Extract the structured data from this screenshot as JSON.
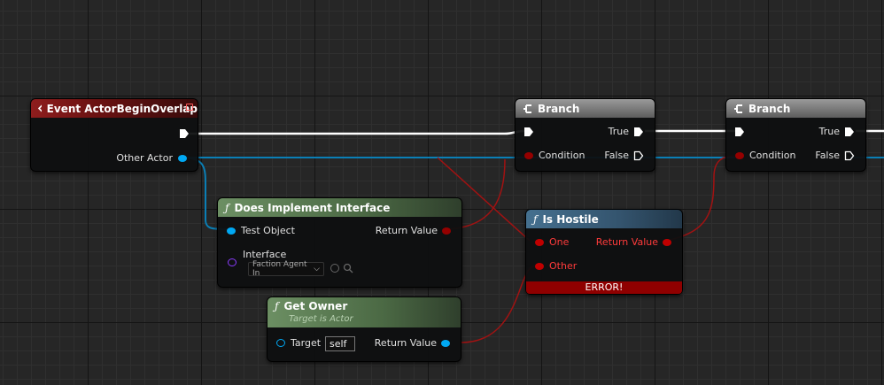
{
  "nodes": {
    "event_overlap": {
      "title": "Event ActorBeginOverlap",
      "pins": {
        "other_actor": "Other Actor"
      }
    },
    "branch1": {
      "title": "Branch",
      "pins": {
        "condition": "Condition",
        "true": "True",
        "false": "False"
      }
    },
    "branch2": {
      "title": "Branch",
      "pins": {
        "condition": "Condition",
        "true": "True",
        "false": "False"
      }
    },
    "does_implement": {
      "title": "Does Implement Interface",
      "pins": {
        "test_object": "Test Object",
        "return_value": "Return Value",
        "interface": "Interface"
      },
      "interface_value": "Faction Agent In"
    },
    "is_hostile": {
      "title": "Is Hostile",
      "pins": {
        "one": "One",
        "other": "Other",
        "return_value": "Return Value"
      },
      "error": "ERROR!"
    },
    "get_owner": {
      "title": "Get Owner",
      "subtitle": "Target is Actor",
      "pins": {
        "target": "Target",
        "return_value": "Return Value"
      },
      "target_value": "self"
    }
  },
  "colors": {
    "exec": "#ffffff",
    "object": "#00a8f3",
    "bool": "#950000",
    "interface": "#8b3cff"
  },
  "icons": {
    "function": "ƒ",
    "event": "event-diamond-icon",
    "branch": "branch-icon"
  }
}
